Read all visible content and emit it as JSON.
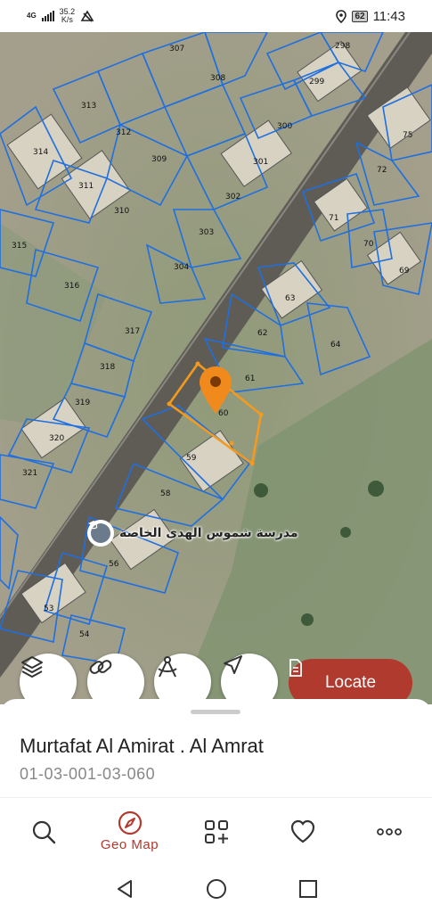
{
  "status_bar": {
    "network": "4G",
    "speed_value": "35.2",
    "speed_unit": "K/s",
    "battery": "62",
    "time": "11:43"
  },
  "map": {
    "plots": [
      "307",
      "308",
      "298",
      "299",
      "313",
      "312",
      "309",
      "300",
      "301",
      "314",
      "311",
      "310",
      "302",
      "303",
      "304",
      "75",
      "72",
      "71",
      "70",
      "69",
      "315",
      "316",
      "63",
      "62",
      "64",
      "317",
      "318",
      "61",
      "60",
      "319",
      "320",
      "59",
      "321",
      "58",
      "56",
      "53",
      "54"
    ],
    "school_label": "مدرسة شموس الهدى الخاصة"
  },
  "map_controls": {
    "layers_icon": "layers-icon",
    "link_icon": "link-icon",
    "measure_icon": "compass-measure-icon",
    "navigate_icon": "navigation-arrow-icon",
    "locate_label": "Locate"
  },
  "sheet": {
    "title": "Murtafat Al Amirat . Al Amrat",
    "code": "01-03-001-03-060"
  },
  "bottom_nav": {
    "geo_map_label": "Geo Map"
  },
  "colors": {
    "accent": "#b03a2e",
    "parcel_line": "#1f6fe0",
    "selection": "#f39a1f"
  }
}
